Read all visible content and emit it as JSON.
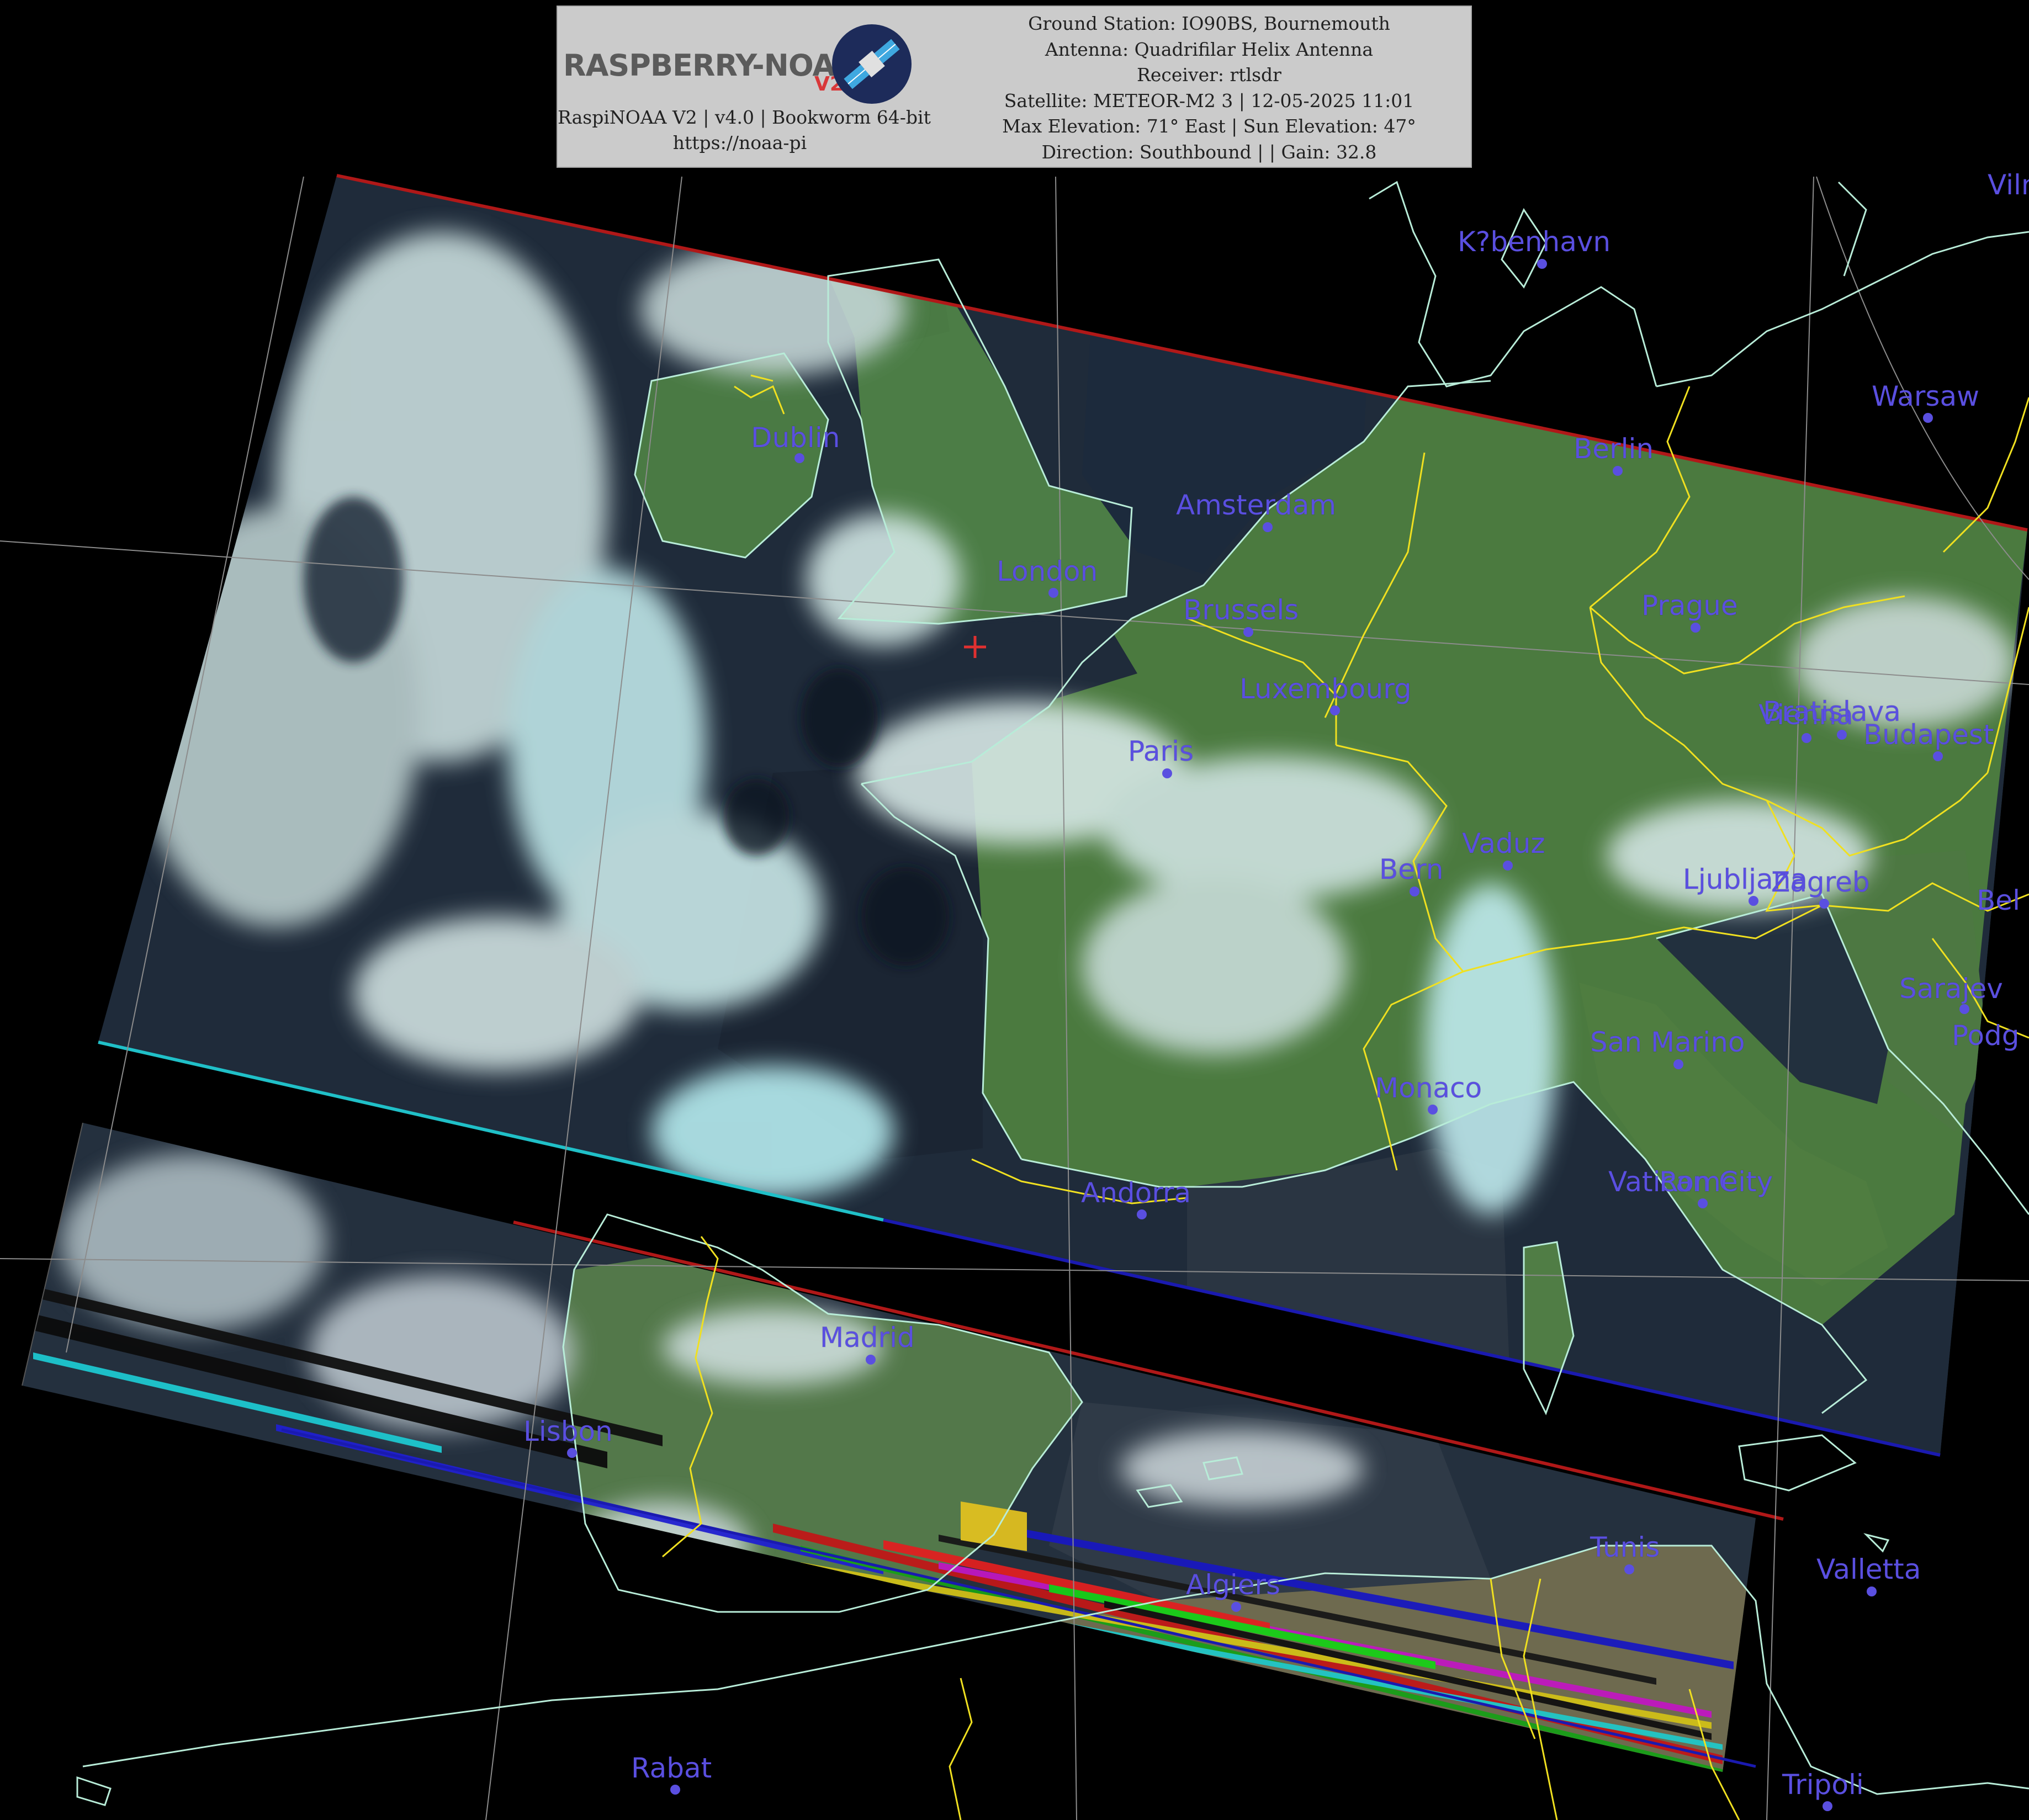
{
  "header": {
    "logo_text": "RASPBERRY-NOAA",
    "logo_version": "V2",
    "software_line": "RaspiNOAA V2 | v4.0 | Bookworm 64-bit",
    "url": "https://noaa-pi",
    "ground_station": "Ground Station: IO90BS, Bournemouth",
    "antenna": "Antenna: Quadrifilar Helix Antenna",
    "receiver": "Receiver: rtlsdr",
    "satellite": "Satellite: METEOR-M2 3 | 12-05-2025 11:01",
    "elevation": "Max Elevation: 71° East | Sun Elevation: 47°",
    "direction": "Direction: Southbound | | Gain: 32.8"
  },
  "colors": {
    "background": "#000000",
    "city_label": "#5a4fe0",
    "coastline": "#b8ecd8",
    "border": "#f0e020",
    "graticule": "#9a9a9a",
    "land": "#3f6b3a",
    "sea": "#1c2836",
    "cloud": "#d8f0f0",
    "station_marker": "#e03030"
  },
  "cities": [
    {
      "name": "K?benhavn"
    },
    {
      "name": "Vilnius",
      "display": "Viln"
    },
    {
      "name": "Warsaw"
    },
    {
      "name": "Berlin"
    },
    {
      "name": "Dublin"
    },
    {
      "name": "Amsterdam"
    },
    {
      "name": "London"
    },
    {
      "name": "Brussels"
    },
    {
      "name": "Prague"
    },
    {
      "name": "Luxembourg"
    },
    {
      "name": "Vienna"
    },
    {
      "name": "Bratislava"
    },
    {
      "name": "Budapest"
    },
    {
      "name": "Paris"
    },
    {
      "name": "Belgrade",
      "display": "Bel"
    },
    {
      "name": "Bern"
    },
    {
      "name": "Vaduz"
    },
    {
      "name": "Ljubljana"
    },
    {
      "name": "Zagreb"
    },
    {
      "name": "Sarajevo",
      "display": "Sarajev"
    },
    {
      "name": "San Marino"
    },
    {
      "name": "Podgorica",
      "display": "Podg"
    },
    {
      "name": "Monaco"
    },
    {
      "name": "Vatican City"
    },
    {
      "name": "Rome"
    },
    {
      "name": "Andorra"
    },
    {
      "name": "Madrid"
    },
    {
      "name": "Lisbon"
    },
    {
      "name": "Tunis"
    },
    {
      "name": "Valletta"
    },
    {
      "name": "Algiers"
    },
    {
      "name": "Rabat"
    },
    {
      "name": "Tripoli"
    }
  ],
  "station_marker": {
    "name": "Bournemouth ground station",
    "symbol": "+"
  }
}
